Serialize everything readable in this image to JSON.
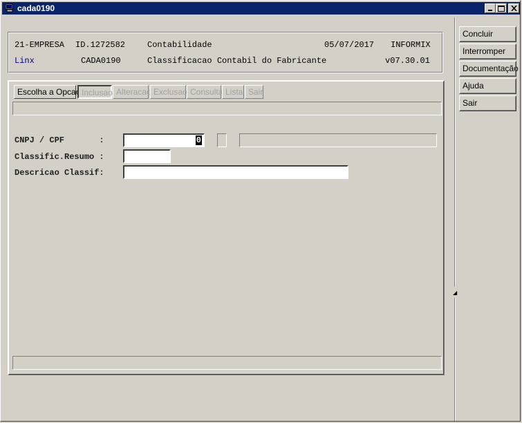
{
  "window": {
    "title": "cada0190"
  },
  "header": {
    "line1": {
      "company": "21-EMPRESA",
      "id": "ID.1272582",
      "module": "Contabilidade",
      "date": "05/07/2017",
      "db": "INFORMIX"
    },
    "line2": {
      "brand": "Linx",
      "program": "CADA0190",
      "description": "Classificacao Contabil do Fabricante",
      "version": "v07.30.01"
    },
    "brand_color": "#000080"
  },
  "menu": {
    "items": [
      {
        "label": "Escolha a Opcao",
        "enabled": true
      },
      {
        "label": "Inclusao",
        "enabled": false
      },
      {
        "label": "Alteracao",
        "enabled": false
      },
      {
        "label": "Exclusao",
        "enabled": false
      },
      {
        "label": "Consulta",
        "enabled": false
      },
      {
        "label": "Lista",
        "enabled": false
      },
      {
        "label": "Sair",
        "enabled": false
      }
    ]
  },
  "form": {
    "cnpj_label": "CNPJ / CPF       :",
    "cnpj_value": "0",
    "resumo_label": "Classific.Resumo :",
    "resumo_value": "",
    "descricao_label": "Descricao Classif:",
    "descricao_value": ""
  },
  "sidebar": {
    "buttons": [
      {
        "label": "Concluir"
      },
      {
        "label": "Interromper"
      },
      {
        "label": "Documentação"
      },
      {
        "label": "Ajuda"
      },
      {
        "label": "Sair"
      }
    ]
  }
}
